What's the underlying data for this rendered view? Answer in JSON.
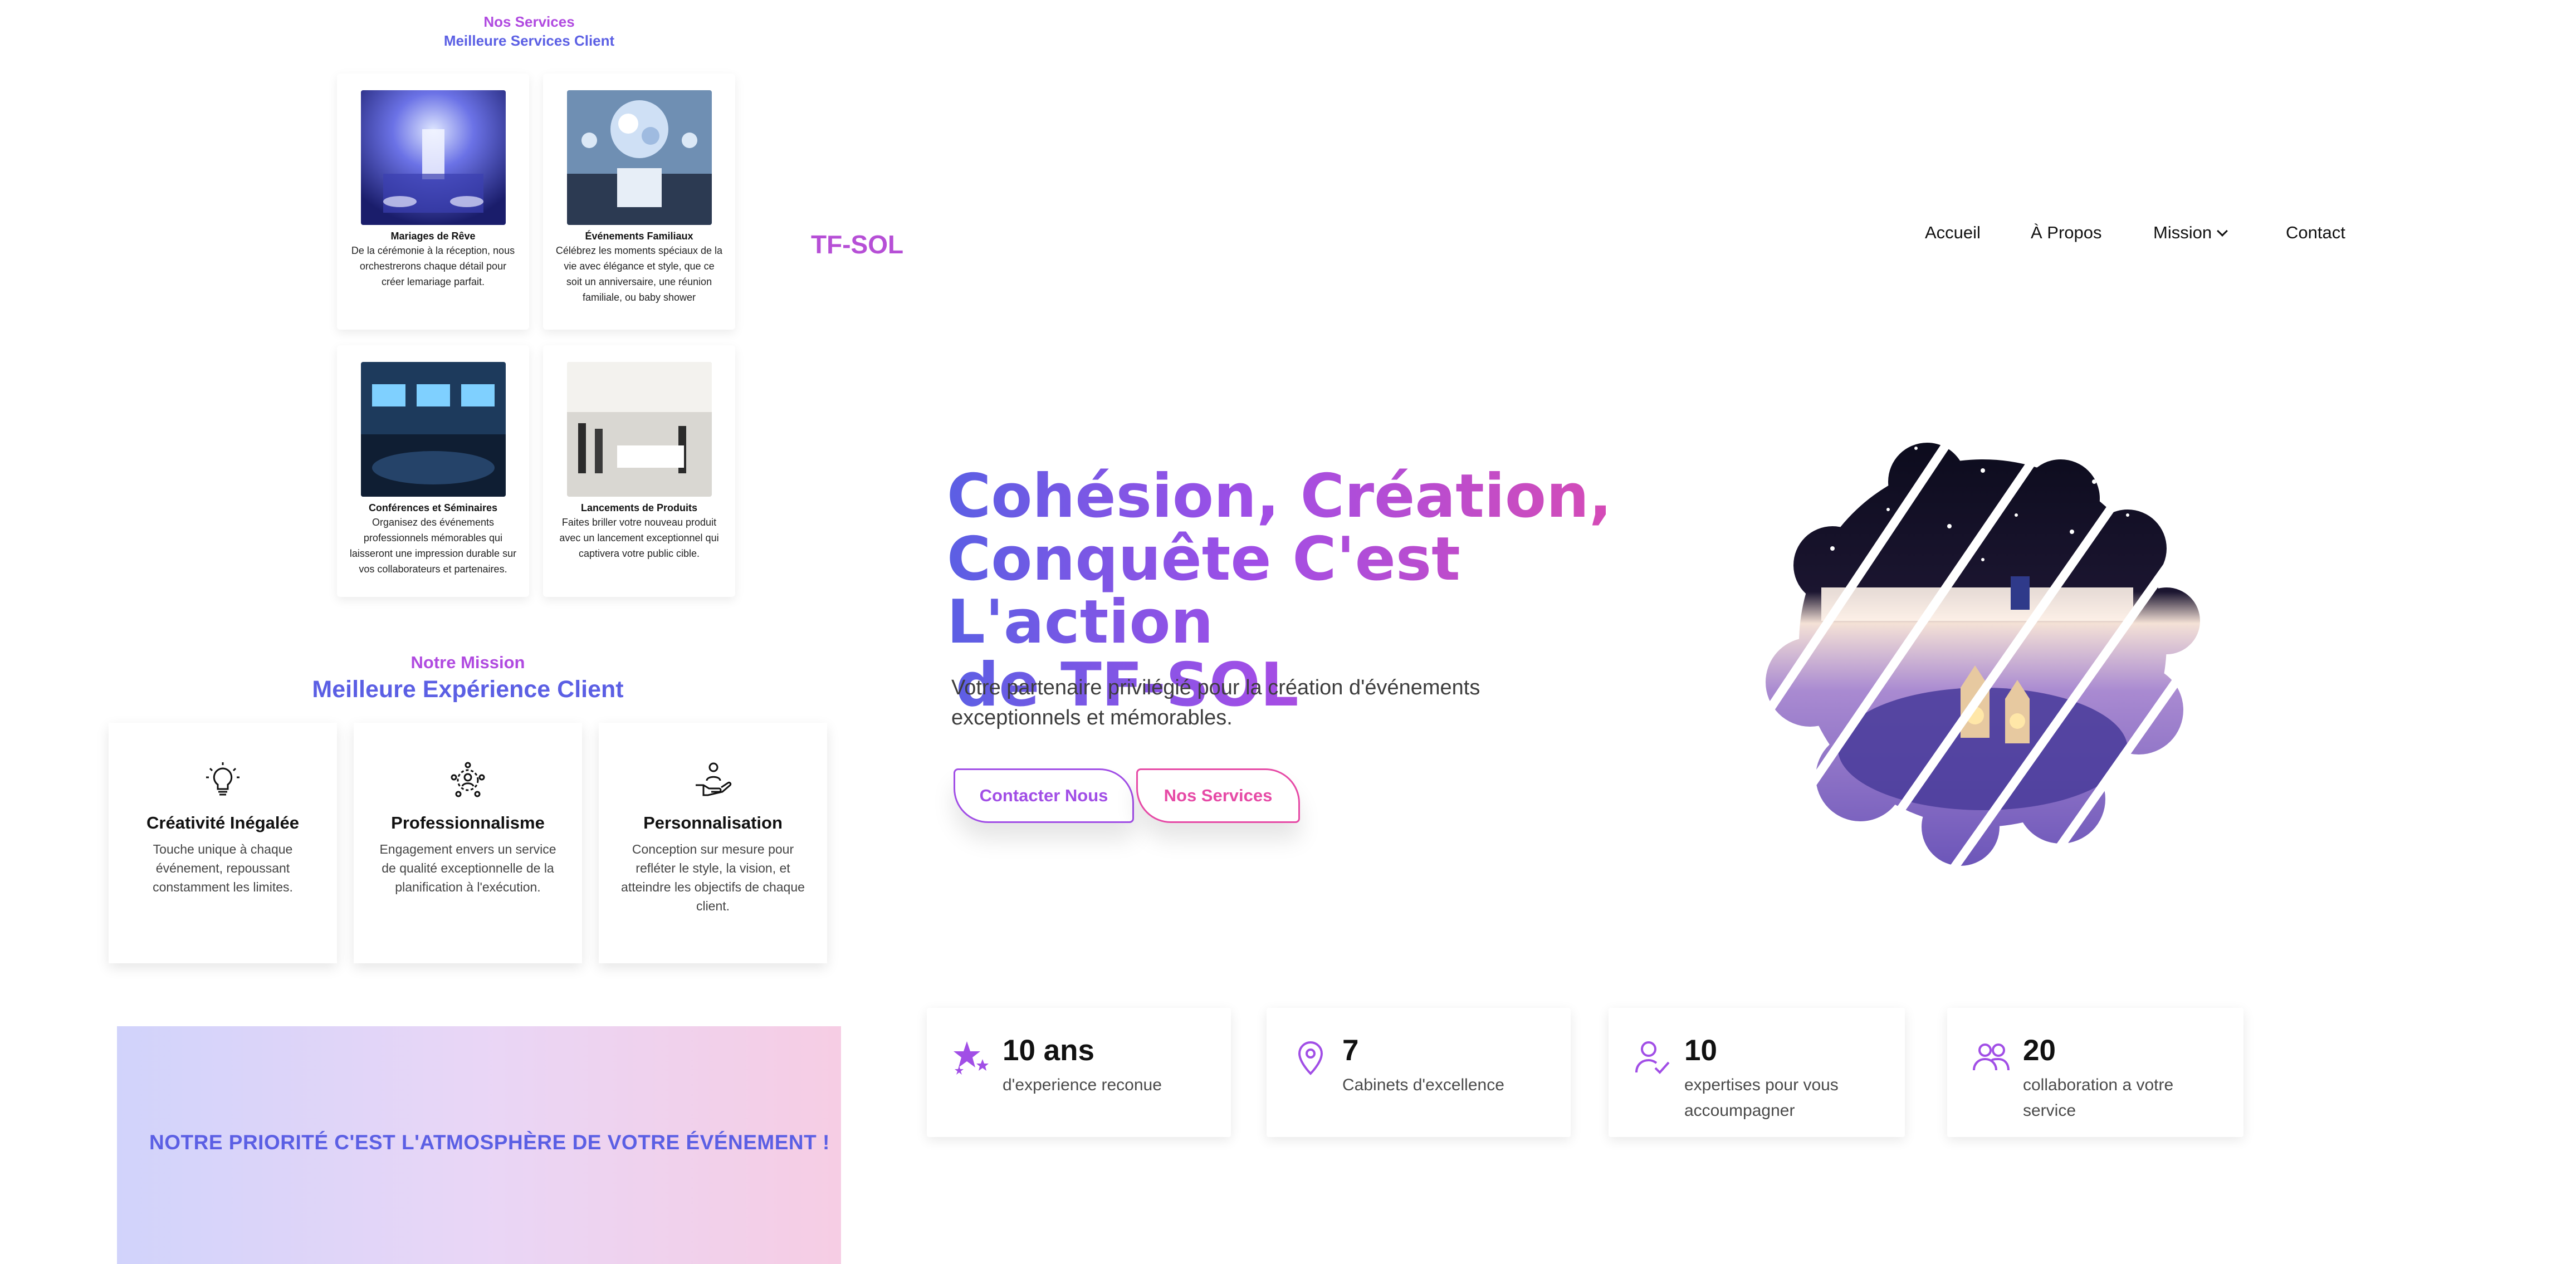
{
  "services": {
    "eyebrow": "Nos Services",
    "title": "Meilleure Services Client",
    "cards": [
      {
        "title": "Mariages de Rêve",
        "desc": "De la cérémonie à la réception, nous orchestrerons chaque détail pour créer lemariage parfait."
      },
      {
        "title": "Événements Familiaux",
        "desc": "Célébrez les moments spéciaux de la vie avec élégance et style, que ce soit un anniversaire, une réunion familiale, ou baby shower"
      },
      {
        "title": "Conférences et Séminaires",
        "desc": "Organisez des événements professionnels mémorables qui laisseront une impression durable sur vos collaborateurs et partenaires."
      },
      {
        "title": "Lancements de Produits",
        "desc": "Faites briller votre nouveau produit avec un lancement exceptionnel qui captivera votre public cible."
      }
    ]
  },
  "mission": {
    "eyebrow": "Notre Mission",
    "title": "Meilleure Expérience Client",
    "cards": [
      {
        "icon": "lightbulb-icon",
        "title": "Créativité Inégalée",
        "desc": "Touche unique à chaque événement, repoussant constamment les limites."
      },
      {
        "icon": "team-gear-icon",
        "title": "Professionnalisme",
        "desc": "Engagement envers un service de qualité exceptionnelle de la planification à l'exécution."
      },
      {
        "icon": "hand-person-icon",
        "title": "Personnalisation",
        "desc": "Conception sur mesure pour refléter le style, la vision, et atteindre les objectifs de chaque client."
      }
    ]
  },
  "banner": {
    "text": "NOTRE PRIORITÉ C'EST L'ATMOSPHÈRE DE VOTRE ÉVÉNEMENT !"
  },
  "header": {
    "logo": "TF-SOL",
    "nav": {
      "home": "Accueil",
      "about": "À Propos",
      "mission": "Mission",
      "contact": "Contact"
    }
  },
  "hero": {
    "title_line1": "Cohésion, Création,",
    "title_line2": "Conquête C'est L'action",
    "title_line3": "de TF-SOL",
    "subtitle_line1": "Votre partenaire privilégié pour la création d'événements",
    "subtitle_line2": "exceptionnels et mémorables.",
    "btn_contact": "Contacter Nous",
    "btn_services": "Nos Services"
  },
  "stats": [
    {
      "icon": "stars-icon",
      "value": "10 ans",
      "label": "d'experience reconue"
    },
    {
      "icon": "location-pin-icon",
      "value": "7",
      "label": "Cabinets d'excellence"
    },
    {
      "icon": "user-check-icon",
      "value": "10",
      "label": "expertises pour vous accoumpagner"
    },
    {
      "icon": "users-icon",
      "value": "20",
      "label": "collaboration a votre service"
    }
  ],
  "colors": {
    "violet": "#a14ee6",
    "indigo": "#5b5fe4",
    "pink": "#e64aa6"
  }
}
